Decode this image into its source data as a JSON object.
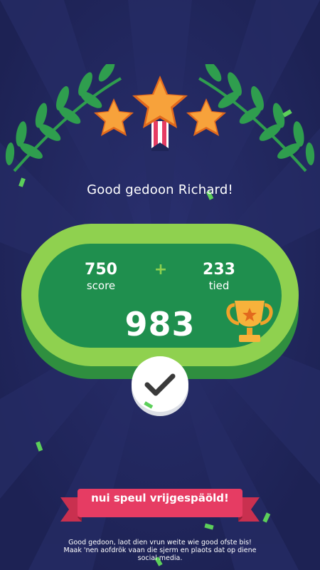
{
  "greeting": "Good gedoon Richard!",
  "stars_earned": 3,
  "score": {
    "value": "750",
    "label": "score"
  },
  "plus_sign": "+",
  "time_bonus": {
    "value": "233",
    "label": "tied"
  },
  "total": "983",
  "banner": {
    "label": "nui speul vrijgespäöld!"
  },
  "footer": {
    "line1": "Good gedoon, laot dien vrun weite wie good ofste bis!",
    "line2": "Maak 'nen aofdrök vaan die sjerm en plaots dat op diene",
    "line3": "social media."
  },
  "colors": {
    "background": "#1f2458",
    "board_outer": "#8fd14f",
    "board_inner": "#1f8f4e",
    "star": "#f7a23b",
    "banner": "#e63c63",
    "leaf": "#2f9e4e"
  }
}
